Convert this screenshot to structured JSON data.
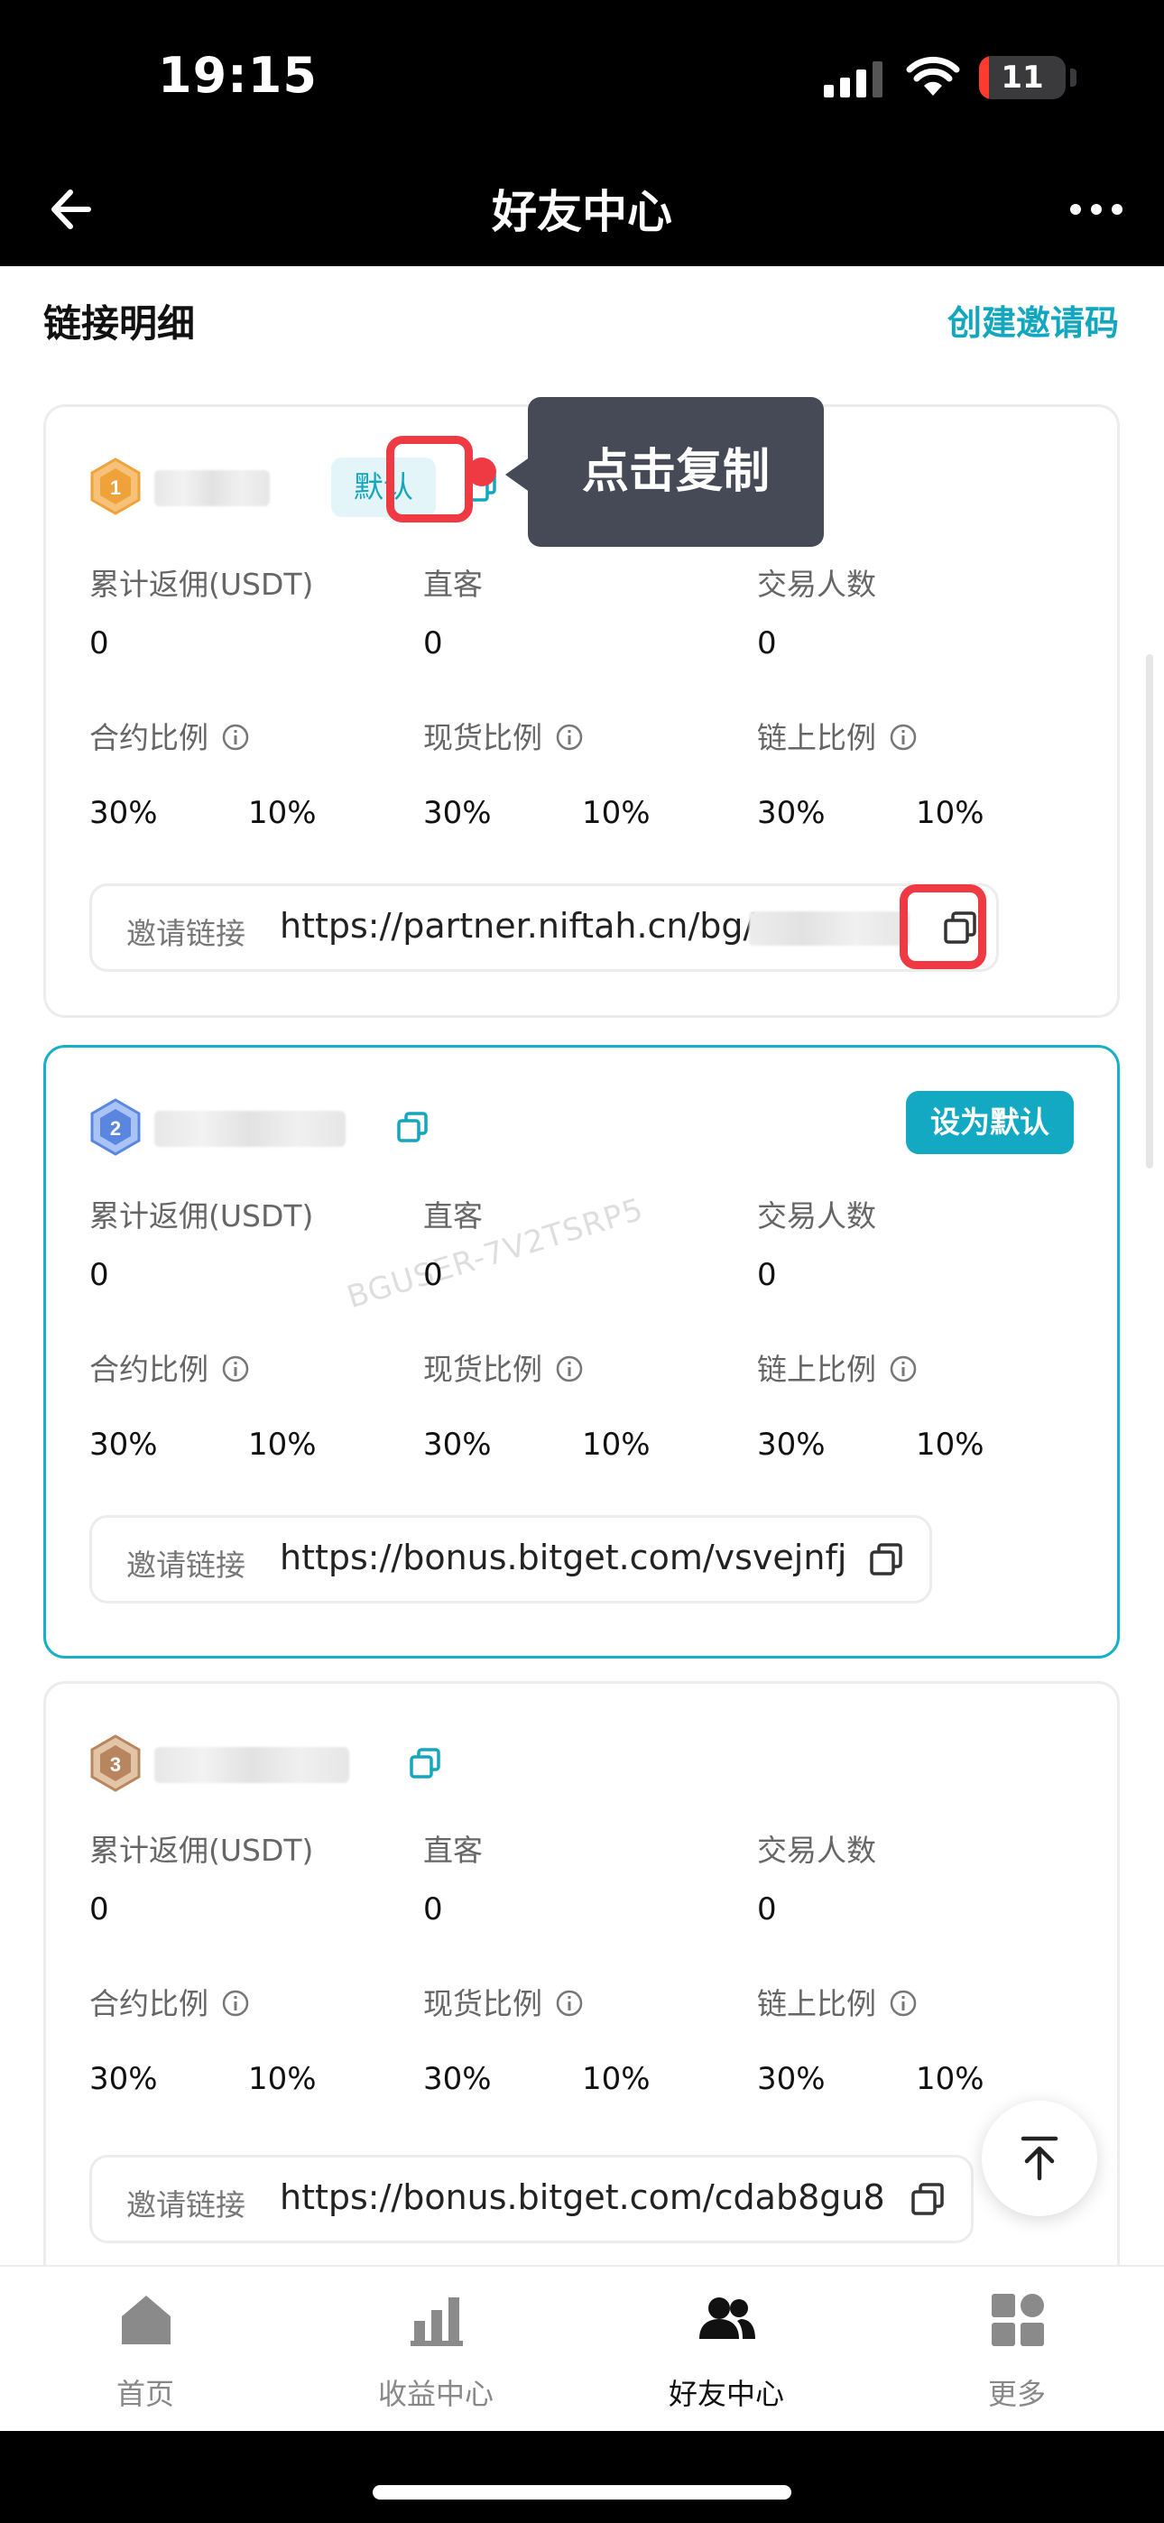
{
  "status_bar": {
    "time": "19:15",
    "battery": "11",
    "battery_level": 0.11
  },
  "nav": {
    "title": "好友中心"
  },
  "section": {
    "title": "链接明细",
    "create_label": "创建邀请码"
  },
  "labels": {
    "rebate": "累计返佣(USDT)",
    "direct": "直客",
    "traders": "交易人数",
    "contract_ratio": "合约比例",
    "spot_ratio": "现货比例",
    "onchain_ratio": "链上比例",
    "invite_link": "邀请链接",
    "default_tag": "默认",
    "set_default": "设为默认"
  },
  "tooltip": "点击复制",
  "watermark": "BGUSER-7V2TSRP5",
  "cards": [
    {
      "rank": "1",
      "rank_color": "#f0a23a",
      "is_default": true,
      "rebate": "0",
      "direct": "0",
      "traders": "0",
      "contract": [
        "30%",
        "10%"
      ],
      "spot": [
        "30%",
        "10%"
      ],
      "onchain": [
        "30%",
        "10%"
      ],
      "link": "https://partner.niftah.cn/bg/"
    },
    {
      "rank": "2",
      "rank_color": "#5b86e0",
      "is_default": false,
      "rebate": "0",
      "direct": "0",
      "traders": "0",
      "contract": [
        "30%",
        "10%"
      ],
      "spot": [
        "30%",
        "10%"
      ],
      "onchain": [
        "30%",
        "10%"
      ],
      "link": "https://bonus.bitget.com/vsvejnfj"
    },
    {
      "rank": "3",
      "rank_color": "#b8865e",
      "is_default": false,
      "rebate": "0",
      "direct": "0",
      "traders": "0",
      "contract": [
        "30%",
        "10%"
      ],
      "spot": [
        "30%",
        "10%"
      ],
      "onchain": [
        "30%",
        "10%"
      ],
      "link": "https://bonus.bitget.com/cdab8gu8"
    }
  ],
  "tabs": [
    {
      "label": "首页",
      "icon": "home-icon"
    },
    {
      "label": "收益中心",
      "icon": "bar-chart-icon"
    },
    {
      "label": "好友中心",
      "icon": "friends-icon",
      "active": true
    },
    {
      "label": "更多",
      "icon": "grid-icon"
    }
  ],
  "colors": {
    "accent": "#13a9c3",
    "highlight": "#ef3a44",
    "tooltip_bg": "#464956"
  }
}
